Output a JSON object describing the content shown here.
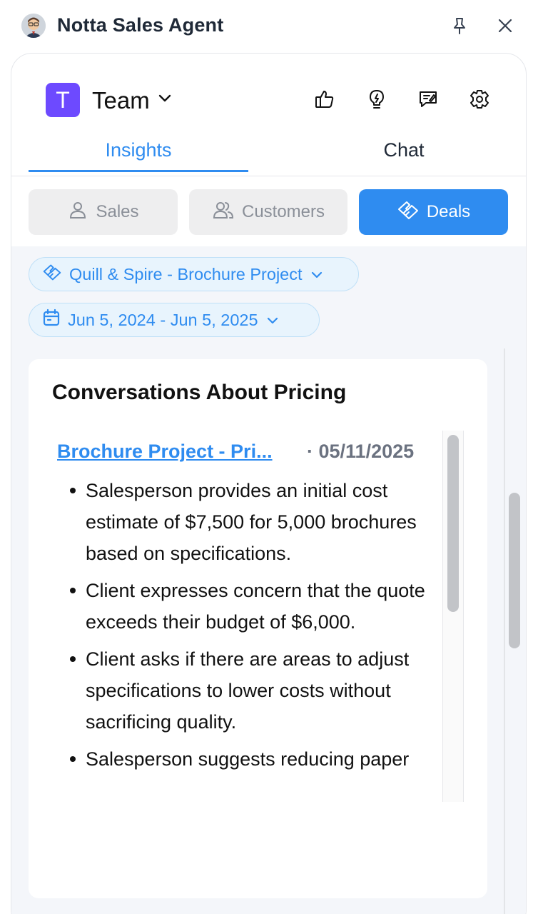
{
  "app": {
    "title": "Notta Sales Agent"
  },
  "header": {
    "team_initial": "T",
    "team_label": "Team"
  },
  "tabs": [
    {
      "label": "Insights",
      "active": true
    },
    {
      "label": "Chat",
      "active": false
    }
  ],
  "segments": [
    {
      "label": "Sales",
      "icon": "user-icon",
      "active": false
    },
    {
      "label": "Customers",
      "icon": "users-icon",
      "active": false
    },
    {
      "label": "Deals",
      "icon": "handshake-icon",
      "active": true
    }
  ],
  "filters": {
    "deal": "Quill & Spire - Brochure Project",
    "date_range": "Jun 5, 2024 - Jun 5, 2025"
  },
  "card": {
    "title": "Conversations About Pricing",
    "conversation": {
      "link": "Brochure Project - Pri...",
      "date": "· 05/11/2025",
      "bullets": [
        "Salesperson provides an initial cost estimate of $7,500 for 5,000 brochures based on specifications.",
        "Client expresses concern that the quote exceeds their budget of $6,000.",
        "Client asks if there are areas to adjust specifications to lower costs without sacrificing quality.",
        "Salesperson suggests reducing paper"
      ]
    }
  },
  "colors": {
    "accent": "#2f8cf0",
    "team_tile": "#6d4aff",
    "chip_bg": "#e8f4fd"
  },
  "icons": [
    "pin-icon",
    "close-icon",
    "chevron-down-icon",
    "thumbs-up-icon",
    "lightbulb-icon",
    "feedback-icon",
    "gear-icon",
    "calendar-icon"
  ]
}
